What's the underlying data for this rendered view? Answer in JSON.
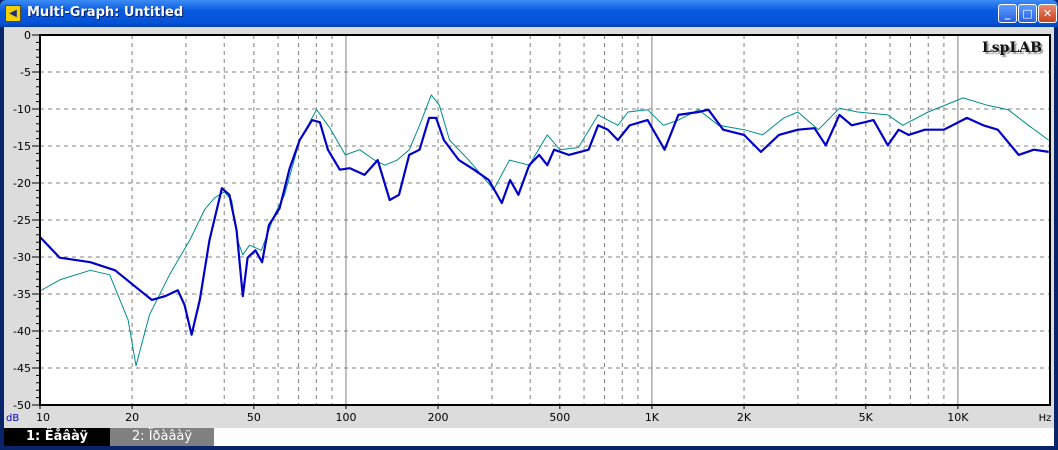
{
  "window": {
    "title": "Multi-Graph: Untitled",
    "icon": "speaker-icon"
  },
  "logo": "LspLAB",
  "tabs": [
    {
      "label": "1: Ëåâàÿ",
      "active": true
    },
    {
      "label": "2: Ïðàâàÿ",
      "active": false
    }
  ],
  "colors": {
    "series1": "#0000c8",
    "series2": "#008c8c",
    "grid": "#808080"
  },
  "chart_data": {
    "type": "line",
    "xscale": "log",
    "xlim": [
      10,
      20000
    ],
    "ylim": [
      -50,
      0
    ],
    "ylabel": "dB",
    "xlabel": "Hz",
    "grid": true,
    "yticks": [
      0,
      -5,
      -10,
      -15,
      -20,
      -25,
      -30,
      -35,
      -40,
      -45,
      -50
    ],
    "xticks": [
      {
        "v": 10,
        "l": "10"
      },
      {
        "v": 20,
        "l": "20"
      },
      {
        "v": 50,
        "l": "50"
      },
      {
        "v": 100,
        "l": "100"
      },
      {
        "v": 200,
        "l": "200"
      },
      {
        "v": 500,
        "l": "500"
      },
      {
        "v": 1000,
        "l": "1K"
      },
      {
        "v": 2000,
        "l": "2K"
      },
      {
        "v": 5000,
        "l": "5K"
      },
      {
        "v": 10000,
        "l": "10K"
      }
    ],
    "series": [
      {
        "name": "1: Ëåâàÿ",
        "color": "#0000c8",
        "width": 2.2,
        "points": [
          [
            10,
            -27.3
          ],
          [
            11.6,
            -30.1
          ],
          [
            14.6,
            -30.7
          ],
          [
            17.6,
            -31.8
          ],
          [
            21.2,
            -34.5
          ],
          [
            23.2,
            -35.8
          ],
          [
            25.6,
            -35.3
          ],
          [
            28.2,
            -34.5
          ],
          [
            29.7,
            -36.5
          ],
          [
            31.3,
            -40.5
          ],
          [
            33.3,
            -35.8
          ],
          [
            35.8,
            -27.7
          ],
          [
            39.3,
            -20.7
          ],
          [
            41.6,
            -21.6
          ],
          [
            43.9,
            -26.4
          ],
          [
            46,
            -35.3
          ],
          [
            47.7,
            -30.1
          ],
          [
            50.6,
            -29.1
          ],
          [
            53.2,
            -30.7
          ],
          [
            56,
            -25.7
          ],
          [
            60.7,
            -23.4
          ],
          [
            65.5,
            -18
          ],
          [
            70.6,
            -14.2
          ],
          [
            77.5,
            -11.5
          ],
          [
            82.2,
            -11.8
          ],
          [
            87.3,
            -15.5
          ],
          [
            95.5,
            -18.2
          ],
          [
            103,
            -18
          ],
          [
            115,
            -18.9
          ],
          [
            127,
            -16.9
          ],
          [
            139,
            -22.3
          ],
          [
            149,
            -21.6
          ],
          [
            161,
            -16.2
          ],
          [
            174,
            -15.5
          ],
          [
            187,
            -11.2
          ],
          [
            197,
            -11.2
          ],
          [
            209,
            -14.2
          ],
          [
            234,
            -16.9
          ],
          [
            262,
            -18.2
          ],
          [
            293,
            -19.6
          ],
          [
            323,
            -22.7
          ],
          [
            344,
            -19.6
          ],
          [
            366,
            -21.6
          ],
          [
            397,
            -17.6
          ],
          [
            428,
            -16.2
          ],
          [
            455,
            -17.6
          ],
          [
            479,
            -15.5
          ],
          [
            535,
            -16.2
          ],
          [
            621,
            -15.5
          ],
          [
            667,
            -12.2
          ],
          [
            718,
            -12.8
          ],
          [
            774,
            -14.2
          ],
          [
            846,
            -12.2
          ],
          [
            968,
            -11.5
          ],
          [
            1100,
            -15.5
          ],
          [
            1220,
            -10.8
          ],
          [
            1420,
            -10.4
          ],
          [
            1530,
            -10.1
          ],
          [
            1710,
            -12.8
          ],
          [
            2000,
            -13.5
          ],
          [
            2270,
            -15.8
          ],
          [
            2600,
            -13.5
          ],
          [
            3000,
            -12.8
          ],
          [
            3400,
            -12.6
          ],
          [
            3700,
            -14.9
          ],
          [
            4100,
            -10.8
          ],
          [
            4500,
            -12.2
          ],
          [
            5300,
            -11.5
          ],
          [
            5900,
            -14.9
          ],
          [
            6400,
            -12.8
          ],
          [
            6900,
            -13.5
          ],
          [
            7800,
            -12.8
          ],
          [
            9000,
            -12.8
          ],
          [
            10700,
            -11.2
          ],
          [
            12100,
            -12.2
          ],
          [
            13500,
            -12.8
          ],
          [
            15800,
            -16.2
          ],
          [
            17700,
            -15.5
          ],
          [
            19800,
            -15.8
          ]
        ]
      },
      {
        "name": "2: Ïðàâàÿ",
        "color": "#008c8c",
        "width": 1,
        "points": [
          [
            10,
            -34.6
          ],
          [
            11.6,
            -33.1
          ],
          [
            14.6,
            -31.8
          ],
          [
            16.9,
            -32.4
          ],
          [
            19.4,
            -38.5
          ],
          [
            20.6,
            -44.7
          ],
          [
            22.8,
            -37.8
          ],
          [
            26.5,
            -32.4
          ],
          [
            30.9,
            -27.7
          ],
          [
            34.5,
            -23.6
          ],
          [
            37.2,
            -22
          ],
          [
            40,
            -21.2
          ],
          [
            42.3,
            -22.3
          ],
          [
            44.2,
            -27.7
          ],
          [
            46,
            -29.7
          ],
          [
            48.4,
            -28.4
          ],
          [
            52.9,
            -29.1
          ],
          [
            58.4,
            -24.3
          ],
          [
            63,
            -21.6
          ],
          [
            70.6,
            -14.2
          ],
          [
            80.2,
            -10.1
          ],
          [
            88.7,
            -12.6
          ],
          [
            99.5,
            -16.2
          ],
          [
            111,
            -15.5
          ],
          [
            124,
            -16.9
          ],
          [
            134,
            -17.6
          ],
          [
            147,
            -16.9
          ],
          [
            161,
            -15.5
          ],
          [
            174,
            -12.2
          ],
          [
            190,
            -8.1
          ],
          [
            202,
            -9.5
          ],
          [
            218,
            -14.2
          ],
          [
            252,
            -16.9
          ],
          [
            304,
            -20.9
          ],
          [
            342,
            -16.9
          ],
          [
            397,
            -17.6
          ],
          [
            455,
            -13.5
          ],
          [
            500,
            -15.5
          ],
          [
            575,
            -15.2
          ],
          [
            667,
            -10.8
          ],
          [
            774,
            -12.2
          ],
          [
            835,
            -10.4
          ],
          [
            968,
            -10.1
          ],
          [
            1090,
            -12.2
          ],
          [
            1220,
            -11.5
          ],
          [
            1420,
            -10.1
          ],
          [
            1650,
            -12.2
          ],
          [
            2000,
            -12.8
          ],
          [
            2300,
            -13.5
          ],
          [
            2700,
            -11.2
          ],
          [
            3000,
            -10.4
          ],
          [
            3500,
            -12.8
          ],
          [
            4100,
            -9.9
          ],
          [
            4700,
            -10.4
          ],
          [
            5900,
            -10.8
          ],
          [
            6600,
            -12.2
          ],
          [
            8000,
            -10.4
          ],
          [
            10400,
            -8.5
          ],
          [
            12500,
            -9.5
          ],
          [
            14600,
            -10.1
          ],
          [
            17000,
            -12.2
          ],
          [
            19800,
            -14.2
          ]
        ]
      }
    ]
  }
}
